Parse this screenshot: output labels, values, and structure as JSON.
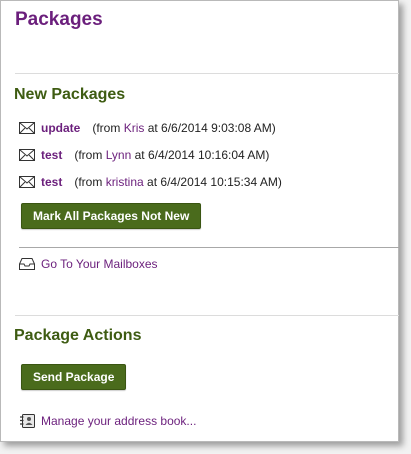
{
  "page": {
    "title": "Packages"
  },
  "new_packages": {
    "heading": "New Packages",
    "items": [
      {
        "name": "update",
        "from_prefix": "(from",
        "user": "Kris",
        "timestamp": "at 6/6/2014 9:03:08 AM)"
      },
      {
        "name": "test",
        "from_prefix": "(from",
        "user": "Lynn",
        "timestamp": "at 6/4/2014 10:16:04 AM)"
      },
      {
        "name": "test",
        "from_prefix": "(from",
        "user": "kristina",
        "timestamp": "at 6/4/2014 10:15:34 AM)"
      }
    ],
    "mark_all_button": "Mark All Packages Not New",
    "mailboxes_link": "Go To Your Mailboxes"
  },
  "package_actions": {
    "heading": "Package Actions",
    "send_button": "Send Package",
    "address_book_link": "Manage your address book..."
  },
  "colors": {
    "title_purple": "#6b1f7c",
    "section_green": "#3e5c12",
    "button_green": "#4a6b1c"
  },
  "icons": {
    "package_item": "envelope-icon",
    "mailboxes": "inbox-tray-icon",
    "address_book": "address-book-icon"
  }
}
